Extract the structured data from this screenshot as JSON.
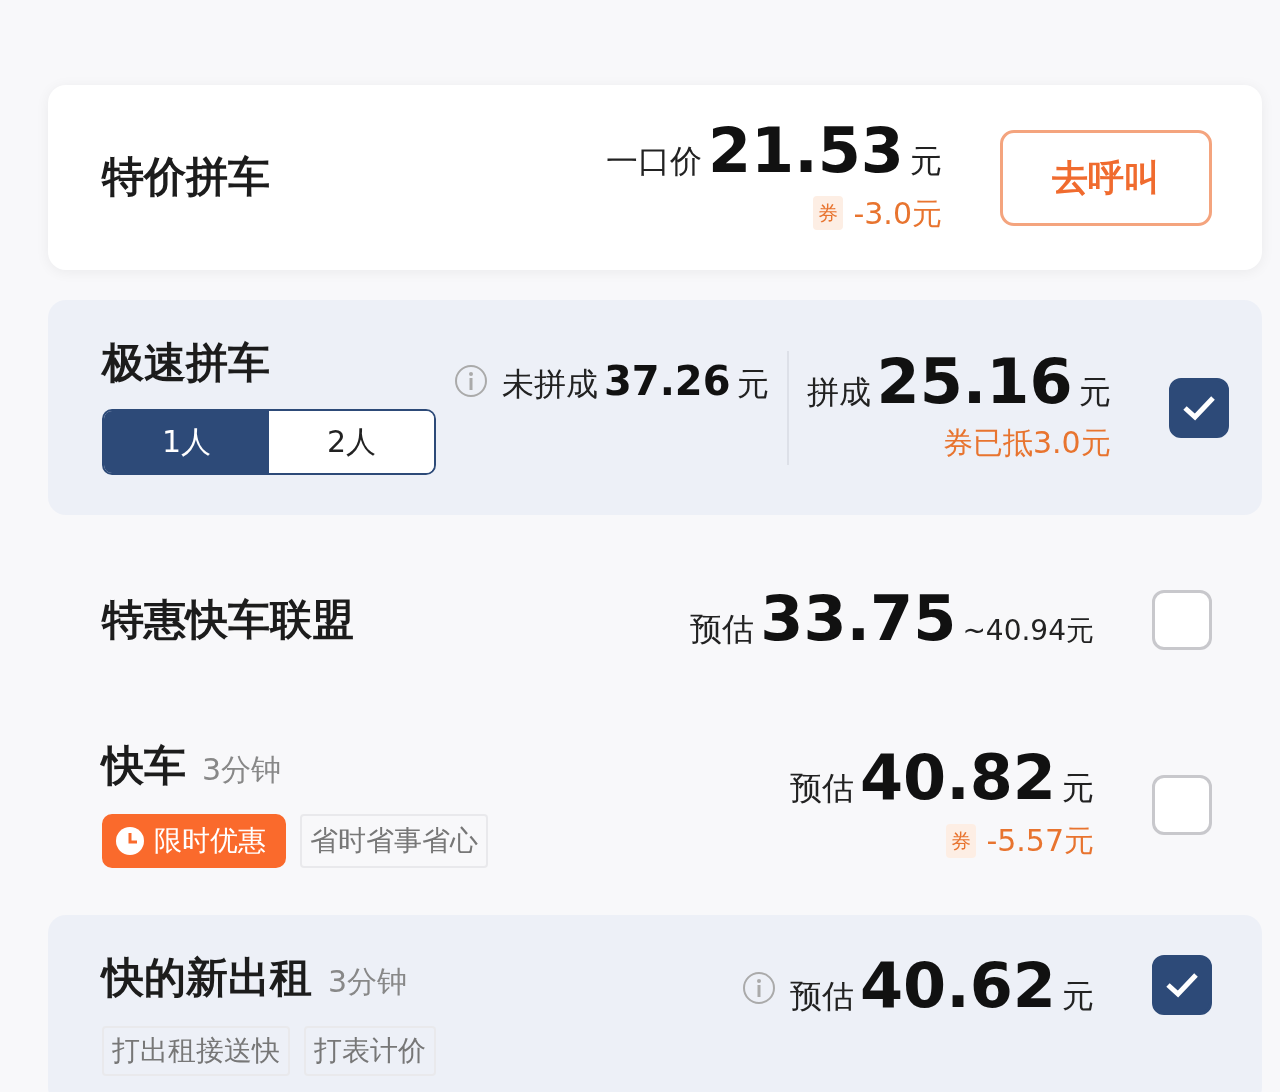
{
  "rides": [
    {
      "name": "特价拼车",
      "kind": "card",
      "price_groups": [
        {
          "info": false,
          "parts": [
            {
              "text": "一口价",
              "kind": "label"
            },
            {
              "text": "21.53",
              "kind": "amount"
            },
            {
              "text": "元",
              "kind": "unit"
            }
          ],
          "coupon": {
            "badge": "券",
            "text": "-3.0元"
          }
        }
      ],
      "action": {
        "kind": "button",
        "label": "去呼叫"
      }
    },
    {
      "name": "极速拼车",
      "kind": "card",
      "options": [
        {
          "label": "1人",
          "selected": true
        },
        {
          "label": "2人",
          "selected": false
        }
      ],
      "price_groups": [
        {
          "info": true,
          "parts": [
            {
              "text": "未拼成",
              "kind": "label"
            },
            {
              "text": "37.26",
              "kind": "amount-small"
            },
            {
              "text": "元",
              "kind": "unit"
            }
          ]
        },
        {
          "info": false,
          "parts": [
            {
              "text": "拼成",
              "kind": "label"
            },
            {
              "text": "25.16",
              "kind": "amount"
            },
            {
              "text": "元",
              "kind": "unit"
            }
          ],
          "note": "券已抵3.0元"
        }
      ],
      "action": {
        "kind": "checkbox",
        "checked": true
      }
    },
    {
      "name": "特惠快车联盟",
      "kind": "plain",
      "price_groups": [
        {
          "info": false,
          "parts": [
            {
              "text": "预估",
              "kind": "label"
            },
            {
              "text": "33.75",
              "kind": "amount"
            },
            {
              "text": "~40.94元",
              "kind": "unit-small"
            }
          ]
        }
      ],
      "action": {
        "kind": "checkbox",
        "checked": false
      }
    },
    {
      "name": "快车",
      "eta": "3分钟",
      "kind": "plain",
      "tags": [
        {
          "text": "限时优惠",
          "kind": "promo"
        },
        {
          "text": "省时省事省心",
          "kind": "plain"
        }
      ],
      "price_groups": [
        {
          "info": false,
          "parts": [
            {
              "text": "预估",
              "kind": "label"
            },
            {
              "text": "40.82",
              "kind": "amount"
            },
            {
              "text": "元",
              "kind": "unit"
            }
          ],
          "coupon": {
            "badge": "券",
            "text": "-5.57元"
          }
        }
      ],
      "action": {
        "kind": "checkbox",
        "checked": false
      }
    },
    {
      "name": "快的新出租",
      "eta": "3分钟",
      "kind": "card",
      "tags": [
        {
          "text": "打出租接送快",
          "kind": "plain"
        },
        {
          "text": "打表计价",
          "kind": "plain"
        }
      ],
      "price_groups": [
        {
          "info": true,
          "parts": [
            {
              "text": "预估",
              "kind": "label"
            },
            {
              "text": "40.62",
              "kind": "amount"
            },
            {
              "text": "元",
              "kind": "unit"
            }
          ]
        }
      ],
      "action": {
        "kind": "checkbox",
        "checked": true
      }
    }
  ]
}
